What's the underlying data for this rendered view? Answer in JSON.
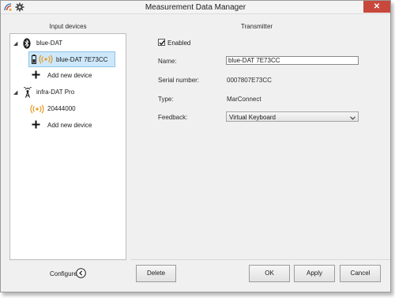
{
  "window": {
    "title": "Measurement Data Manager",
    "close_glyph": "✕",
    "app_icon": "signal-app-icon",
    "settings_icon": "gear-icon"
  },
  "input_devices": {
    "heading": "Input devices",
    "groups": [
      {
        "label": "blue-DAT",
        "icon": "bluetooth-icon",
        "expanded": true,
        "children": [
          {
            "label": "blue-DAT 7E73CC",
            "icon": "battery-signal-icon",
            "selected": true
          },
          {
            "label": "Add new device",
            "icon": "plus-icon"
          }
        ]
      },
      {
        "label": "infra-DAT Pro",
        "icon": "antenna-icon",
        "expanded": true,
        "children": [
          {
            "label": "20444000",
            "icon": "signal-waves-icon"
          },
          {
            "label": "Add new device",
            "icon": "plus-icon"
          }
        ]
      }
    ],
    "configure_label": "Configure"
  },
  "transmitter": {
    "heading": "Transmitter",
    "enabled_label": "Enabled",
    "enabled_checked": true,
    "fields": {
      "name_label": "Name:",
      "name_value": "blue-DAT 7E73CC",
      "serial_label": "Serial number:",
      "serial_value": "0007807E73CC",
      "type_label": "Type:",
      "type_value": "MarConnect",
      "feedback_label": "Feedback:",
      "feedback_value": "Virtual Keyboard"
    }
  },
  "buttons": {
    "delete": "Delete",
    "ok": "OK",
    "apply": "Apply",
    "cancel": "Cancel"
  },
  "colors": {
    "selection": "#cde8fb",
    "close": "#c8483c",
    "signal_orange": "#e79a1e"
  }
}
